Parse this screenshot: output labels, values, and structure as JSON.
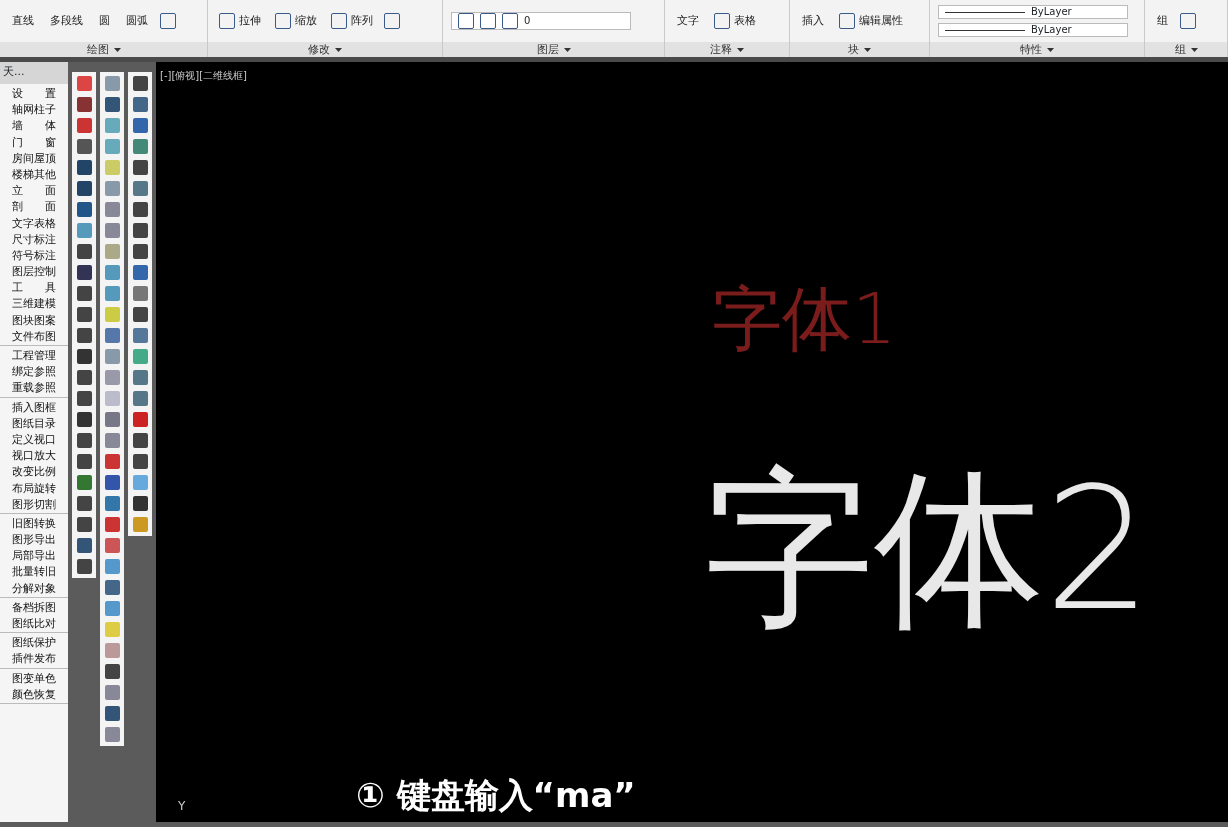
{
  "ribbon": {
    "panels": [
      {
        "title": "绘图",
        "items": [
          {
            "kind": "large",
            "label": "直线"
          },
          {
            "kind": "large",
            "label": "多段线"
          },
          {
            "kind": "large",
            "label": "圆"
          },
          {
            "kind": "large",
            "label": "圆弧"
          },
          {
            "kind": "icon"
          }
        ]
      },
      {
        "title": "修改",
        "items": [
          {
            "kind": "small",
            "label": "拉伸"
          },
          {
            "kind": "small",
            "label": "缩放"
          },
          {
            "kind": "small",
            "label": "阵列"
          },
          {
            "kind": "icon"
          }
        ]
      },
      {
        "title": "图层",
        "items": [
          {
            "kind": "layer",
            "label": "0"
          }
        ]
      },
      {
        "title": "注释",
        "items": [
          {
            "kind": "large",
            "label": "文字"
          },
          {
            "kind": "small",
            "label": "表格"
          }
        ]
      },
      {
        "title": "块",
        "items": [
          {
            "kind": "large",
            "label": "插入"
          },
          {
            "kind": "small",
            "label": "编辑属性"
          }
        ]
      },
      {
        "title": "特性",
        "items": [
          {
            "kind": "linetype",
            "label": "ByLayer"
          },
          {
            "kind": "linetype",
            "label": "ByLayer"
          }
        ]
      },
      {
        "title": "组",
        "items": [
          {
            "kind": "large",
            "label": "组"
          },
          {
            "kind": "icon"
          }
        ]
      }
    ]
  },
  "sidebar": {
    "header": "天...",
    "groups": [
      [
        "设　　置",
        "轴网柱子",
        "墙　　体",
        "门　　窗",
        "房间屋顶",
        "楼梯其他",
        "立　　面",
        "剖　　面",
        "文字表格",
        "尺寸标注",
        "符号标注",
        "图层控制",
        "工　　具",
        "三维建模",
        "图块图案",
        "文件布图"
      ],
      [
        "工程管理",
        "绑定参照",
        "重载参照"
      ],
      [
        "插入图框",
        "图纸目录",
        "定义视口",
        "视口放大",
        "改变比例",
        "布局旋转",
        "图形切割"
      ],
      [
        "旧图转换",
        "图形导出",
        "局部导出",
        "批量转旧",
        "分解对象"
      ],
      [
        "备档拆图",
        "图纸比对"
      ],
      [
        "图纸保护",
        "插件发布"
      ],
      [
        "图变单色",
        "颜色恢复"
      ]
    ]
  },
  "viewport": {
    "label": "[-][俯视][二维线框]",
    "texts": [
      {
        "kind": "small",
        "text": "字体1",
        "color": "#7a1c1c"
      },
      {
        "kind": "large",
        "text": "字体2",
        "color": "#e8e8e8"
      }
    ],
    "axis_label": "Y",
    "caption": "① 键盘输入“ma”"
  }
}
